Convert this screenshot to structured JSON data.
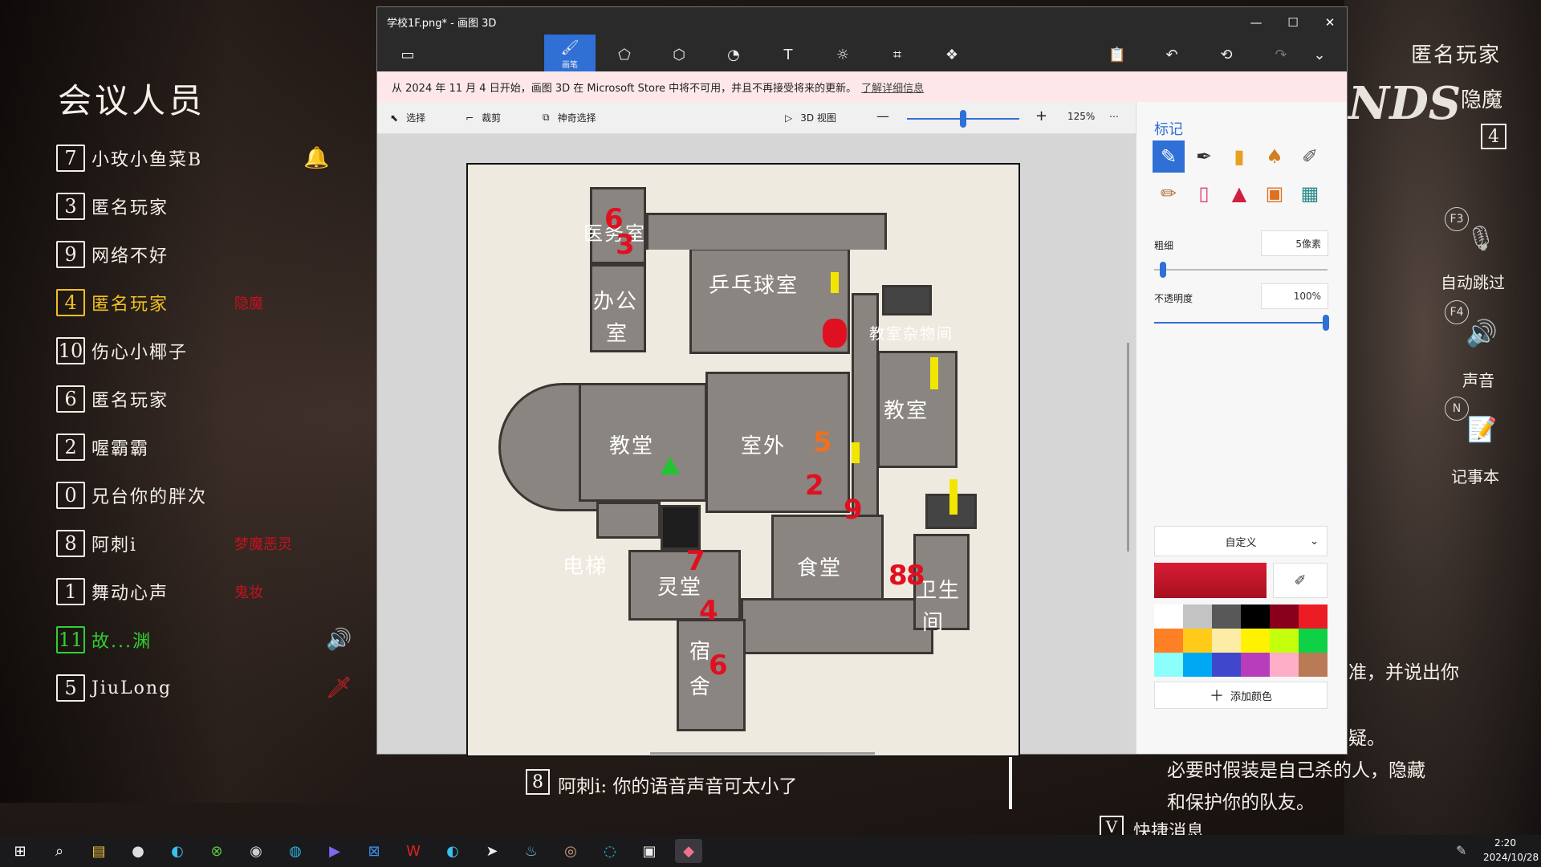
{
  "game": {
    "participants_title": "会议人员",
    "players": [
      {
        "num": "7",
        "name": "小玫小鱼菜B",
        "role": "",
        "color": "#f2eee8",
        "icon": "bell-icon",
        "glyph": "🔔"
      },
      {
        "num": "3",
        "name": "匿名玩家",
        "role": "",
        "color": "#f2eee8",
        "icon": "",
        "glyph": ""
      },
      {
        "num": "9",
        "name": "网络不好",
        "role": "",
        "color": "#f2eee8",
        "icon": "",
        "glyph": ""
      },
      {
        "num": "4",
        "name": "匿名玩家",
        "role": "隐魔",
        "color": "#f0c020",
        "icon": "",
        "glyph": ""
      },
      {
        "num": "10",
        "name": "伤心小椰子",
        "role": "",
        "color": "#f2eee8",
        "icon": "",
        "glyph": ""
      },
      {
        "num": "6",
        "name": "匿名玩家",
        "role": "",
        "color": "#f2eee8",
        "icon": "",
        "glyph": ""
      },
      {
        "num": "2",
        "name": "喔霸霸",
        "role": "",
        "color": "#f2eee8",
        "icon": "",
        "glyph": ""
      },
      {
        "num": "0",
        "name": "兄台你的胖次",
        "role": "",
        "color": "#f2eee8",
        "icon": "",
        "glyph": ""
      },
      {
        "num": "8",
        "name": "阿刺i",
        "role": "梦魔恶灵",
        "color": "#f2eee8",
        "icon": "",
        "glyph": ""
      },
      {
        "num": "1",
        "name": "舞动心声",
        "role": "鬼妆",
        "color": "#f2eee8",
        "icon": "",
        "glyph": ""
      },
      {
        "num": "11",
        "name": "故...渊",
        "role": "",
        "color": "#30d030",
        "icon": "speaker-icon",
        "glyph": "🔊"
      },
      {
        "num": "5",
        "name": "JiuLong",
        "role": "",
        "color": "#f2eee8",
        "icon": "knife-icon",
        "glyph": "🗡"
      }
    ],
    "top_right_name": "匿名玩家",
    "logo_text": "NDS",
    "role_label": "隐魔",
    "role_number": "4",
    "hotkey_f3": "F3",
    "auto_skip": "自动跳过",
    "hotkey_f4": "F4",
    "sound": "声音",
    "hotkey_n": "N",
    "notes": "记事本",
    "right_text_1": "准，并说出你",
    "right_text_2": "疑。",
    "right_text_3": "必要时假装是自己杀的人，隐藏",
    "right_text_4": "和保护你的队友。",
    "quick_msg_key": "V",
    "quick_msg": "快捷消息",
    "chat_num": "8",
    "chat_text": "阿刺i: 你的语音声音可太小了"
  },
  "paint3d": {
    "title": "学校1F.png* - 画图 3D",
    "tools": [
      {
        "name": "brush",
        "glyph": "🖌",
        "label": "画笔"
      },
      {
        "name": "2d-shapes",
        "glyph": "⬠",
        "label": ""
      },
      {
        "name": "3d-shapes",
        "glyph": "⬡",
        "label": ""
      },
      {
        "name": "stickers",
        "glyph": "◔",
        "label": ""
      },
      {
        "name": "text",
        "glyph": "T",
        "label": ""
      },
      {
        "name": "effects",
        "glyph": "☼",
        "label": ""
      },
      {
        "name": "canvas",
        "glyph": "⌗",
        "label": ""
      },
      {
        "name": "3d-library",
        "glyph": "❖",
        "label": ""
      }
    ],
    "notice_text": "从 2024 年 11 月 4 日开始，画图 3D 在 Microsoft Store 中将不可用，并且不再接受将来的更新。",
    "notice_link": "了解详细信息",
    "select": "选择",
    "crop": "裁剪",
    "magic_select": "神奇选择",
    "view3d": "3D 视图",
    "zoom": "125%",
    "zoom_fraction": 0.5,
    "map_labels": {
      "infirmary": "医务室",
      "office1": "办公",
      "office2": "室",
      "pingpong": "乒乓球室",
      "storage": "教室杂物间",
      "church": "教堂",
      "outside": "室外",
      "classroom": "教室",
      "elevator": "电梯",
      "spirit": "灵堂",
      "canteen": "食堂",
      "wc1": "卫生",
      "wc2": "间",
      "dorm1": "宿",
      "dorm2": "舍"
    },
    "map_marks": [
      "6",
      "3",
      "5",
      "2",
      "9",
      "7",
      "4",
      "6",
      "8",
      "8"
    ],
    "side_title": "标记",
    "brushes": [
      {
        "name": "marker-brush",
        "glyph": "✎"
      },
      {
        "name": "calligraphy-pen",
        "glyph": "✒"
      },
      {
        "name": "oil-brush",
        "glyph": "▮"
      },
      {
        "name": "watercolor",
        "glyph": "♠"
      },
      {
        "name": "pixel-pen",
        "glyph": "✐"
      },
      {
        "name": "pencil",
        "glyph": "✏"
      },
      {
        "name": "eraser",
        "glyph": "▯"
      },
      {
        "name": "crayon",
        "glyph": "▲"
      },
      {
        "name": "spray-can",
        "glyph": "▣"
      },
      {
        "name": "fill",
        "glyph": "▦"
      }
    ],
    "thickness_label": "粗细",
    "thickness_value": "5像素",
    "thickness_fraction": 0.05,
    "opacity_label": "不透明度",
    "opacity_value": "100%",
    "opacity_fraction": 1.0,
    "color_mode": "自定义",
    "current_color": "#d81c34",
    "palette": [
      "#ffffff",
      "#c3c3c3",
      "#585858",
      "#000000",
      "#88001b",
      "#ec1c24",
      "#ff7f27",
      "#ffca18",
      "#fdeca6",
      "#fff200",
      "#c4ff0e",
      "#0ed145",
      "#8cfffb",
      "#00a8f3",
      "#3f48cc",
      "#b83dba",
      "#ffaec8",
      "#b97a56"
    ],
    "add_color": "添加颜色"
  },
  "taskbar": {
    "time": "2:20",
    "date": "2024/10/28",
    "apps": [
      "⊞",
      "⌕",
      "▤",
      "●",
      "◐",
      "⊗",
      "◉",
      "◍",
      "▶",
      "⊠",
      "W",
      "◐",
      "➤",
      "♨",
      "◎",
      "◌",
      "▣",
      "◆"
    ]
  }
}
